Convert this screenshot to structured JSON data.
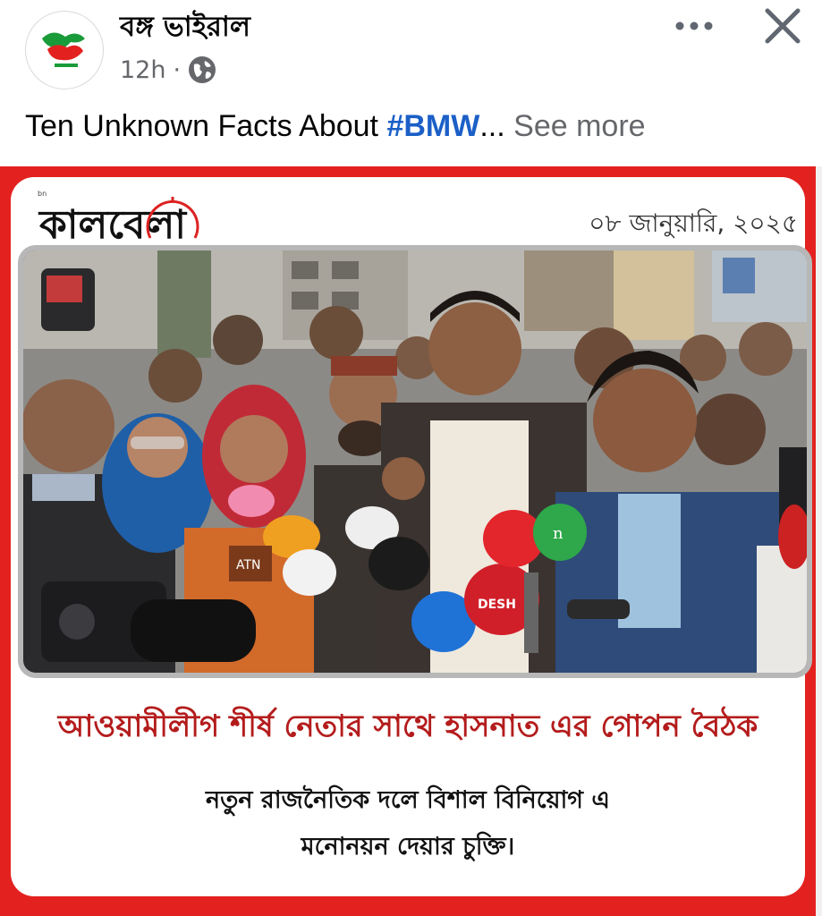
{
  "post": {
    "page_name": "বঙ্গ ভাইরাল",
    "time": "12h",
    "separator": "·",
    "privacy_icon": "globe-icon",
    "more_icon": "more-horizontal-icon",
    "close_icon": "close-icon",
    "caption_text": "Ten Unknown Facts About ",
    "caption_hashtag": "#BMW",
    "caption_ellipsis": "...",
    "see_more": "See more"
  },
  "media": {
    "logo_text": "কালবেলা",
    "date": "০৮ জানুয়ারি, ২০২৫",
    "headline": "আওয়ামীলীগ শীর্ষ নেতার সাথে হাসনাত এর গোপন বৈঠক",
    "subline_1": "নতুন রাজনৈতিক দলে বিশাল বিনিয়োগ এ",
    "subline_2": "মনোনয়ন দেয়ার চুক্তি।",
    "mic_labels": [
      "DESH",
      "ATN",
      "n"
    ],
    "accent_color": "#e3221f",
    "headline_color": "#b41c1c"
  }
}
